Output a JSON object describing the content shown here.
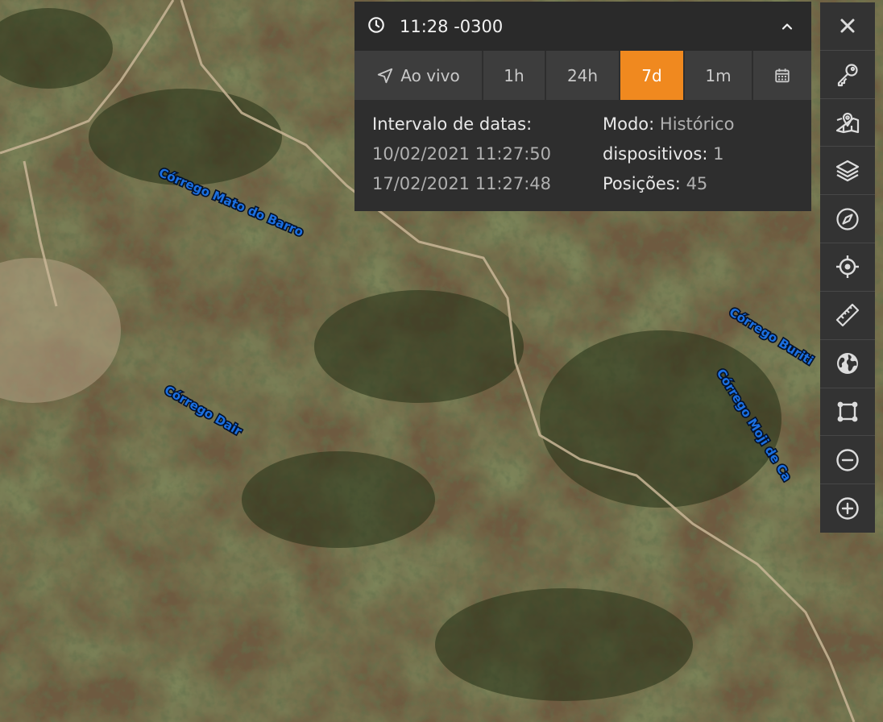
{
  "map": {
    "rivers": [
      {
        "label": "Córrego Mato do Barro"
      },
      {
        "label": "Córrego Dair"
      },
      {
        "label": "Córrego Buriti"
      },
      {
        "label": "Córrego Moji de Ca"
      }
    ]
  },
  "time_panel": {
    "header": {
      "time": "11:28 -0300",
      "clock_icon": "clock-icon",
      "collapse_icon": "chevron-up-icon"
    },
    "ranges": [
      {
        "label": "Ao vivo",
        "icon": "navigation-arrow-icon"
      },
      {
        "label": "1h"
      },
      {
        "label": "24h"
      },
      {
        "label": "7d",
        "active": true
      },
      {
        "label": "1m"
      },
      {
        "label": "",
        "icon": "calendar-icon"
      }
    ],
    "active_color": "#f0891f",
    "info": {
      "interval_label": "Intervalo de datas:",
      "start": "10/02/2021 11:27:50",
      "end": "17/02/2021 11:27:48",
      "mode_label": "Modo:",
      "mode_value": "Histórico",
      "devices_label": "dispositivos:",
      "devices_value": "1",
      "positions_label": "Posições:",
      "positions_value": "45"
    }
  },
  "toolbar": {
    "buttons": [
      {
        "icon": "close-icon"
      },
      {
        "icon": "key-icon"
      },
      {
        "icon": "map-pin-icon"
      },
      {
        "icon": "layers-icon"
      },
      {
        "icon": "compass-icon"
      },
      {
        "icon": "crosshair-icon"
      },
      {
        "icon": "ruler-icon"
      },
      {
        "icon": "globe-icon"
      },
      {
        "icon": "polygon-icon"
      },
      {
        "icon": "zoom-out-icon"
      },
      {
        "icon": "zoom-in-icon"
      }
    ]
  }
}
